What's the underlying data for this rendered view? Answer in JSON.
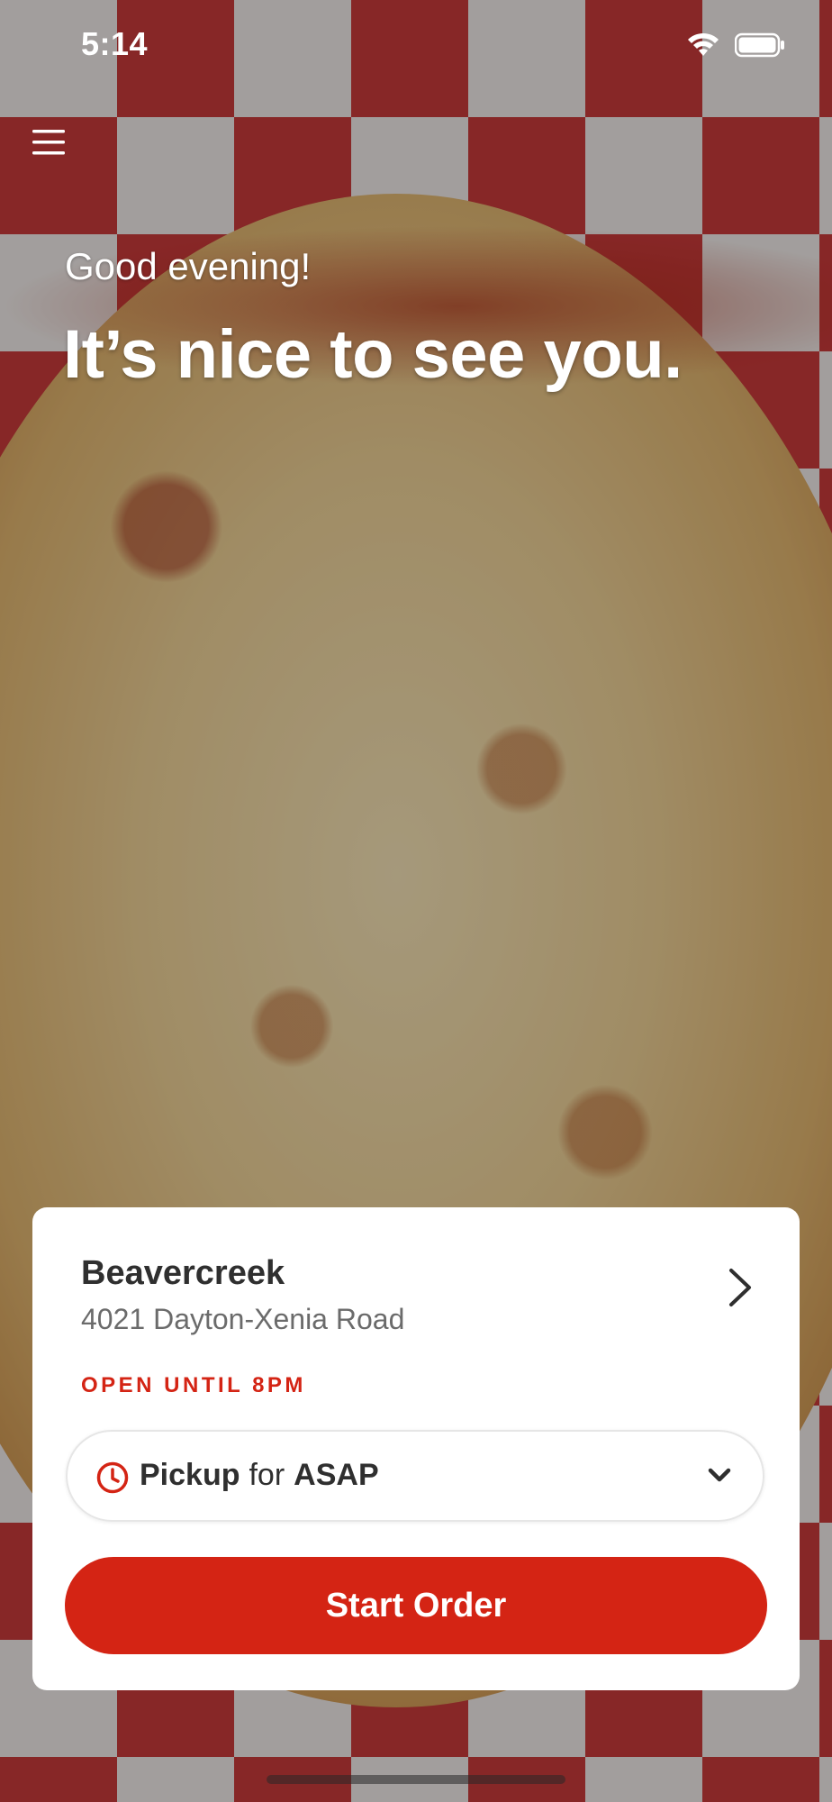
{
  "status_bar": {
    "time": "5:14",
    "icons": [
      "wifi-icon",
      "battery-icon"
    ]
  },
  "header": {
    "menu_icon": "menu-icon"
  },
  "hero": {
    "greeting": "Good evening!",
    "headline": "It’s nice to see you."
  },
  "location": {
    "name": "Beavercreek",
    "address": "4021 Dayton-Xenia Road",
    "status": "OPEN UNTIL 8PM"
  },
  "order_mode": {
    "icon": "clock-icon",
    "mode": "Pickup",
    "connector": "for",
    "time": "ASAP"
  },
  "actions": {
    "start_order_label": "Start Order"
  },
  "colors": {
    "accent": "#d42414",
    "card_background": "#ffffff",
    "text_primary": "#2f2f2f",
    "text_secondary": "#6b6b6b"
  }
}
